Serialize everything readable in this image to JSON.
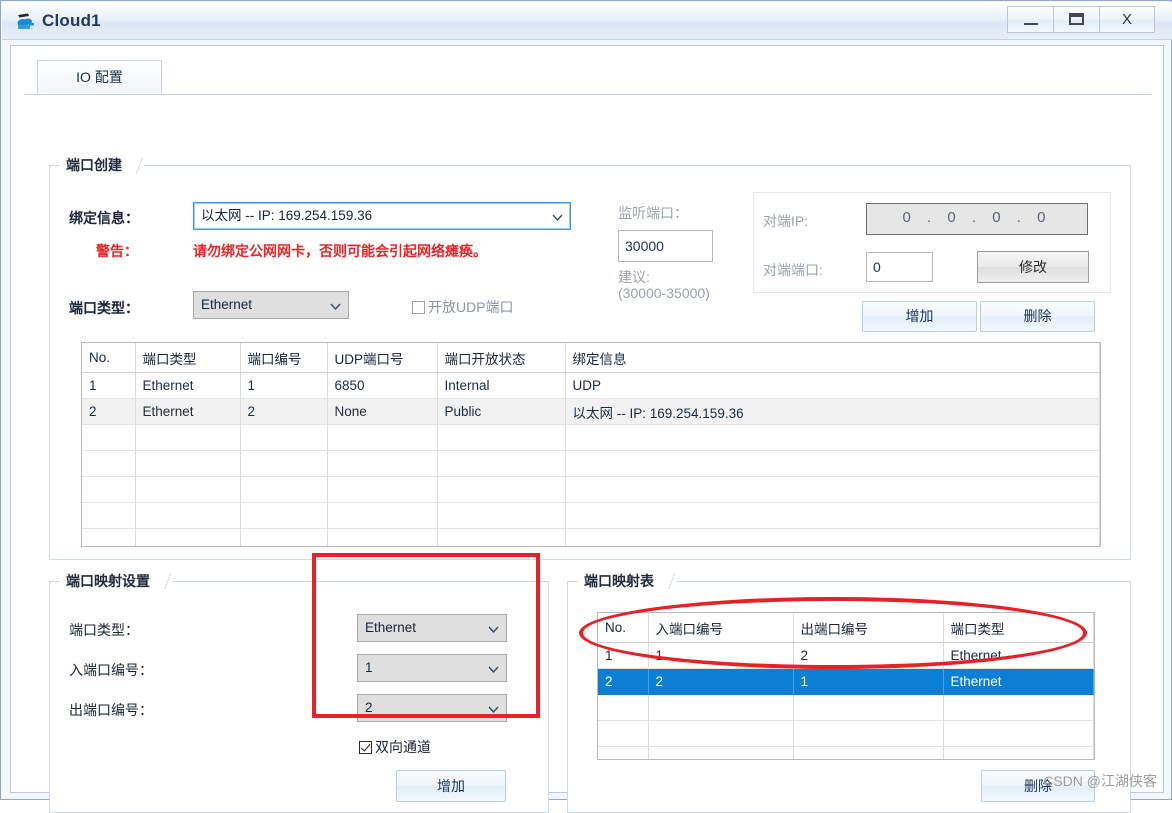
{
  "window": {
    "title": "Cloud1",
    "icon": "cloud-device-icon",
    "controls": {
      "minimize": "minimize-icon",
      "maximize": "maximize-icon",
      "close": "X"
    }
  },
  "tabs": [
    {
      "label": "IO 配置",
      "active": true
    }
  ],
  "port_create": {
    "group_title": "端口创建",
    "bind_info_label": "绑定信息：",
    "bind_info_value": "以太网 -- IP: 169.254.159.36",
    "warning_label": "警告：",
    "warning_text": "请勿绑定公网网卡，否则可能会引起网络瘫痪。",
    "port_type_label": "端口类型：",
    "port_type_value": "Ethernet",
    "udp_checkbox_label": "开放UDP端口",
    "udp_checkbox_checked": false,
    "listen_port_label": "监听端口：",
    "listen_port_value": "30000",
    "suggest_label": "建议:",
    "suggest_range": "(30000-35000)",
    "peer_ip_label": "对端IP:",
    "peer_ip_value": "0 . 0 . 0 . 0",
    "peer_port_label": "对端端口:",
    "peer_port_value": "0",
    "modify_button": "修改",
    "add_button": "增加",
    "delete_button": "删除"
  },
  "port_table": {
    "columns": [
      "No.",
      "端口类型",
      "端口编号",
      "UDP端口号",
      "端口开放状态",
      "绑定信息"
    ],
    "rows": [
      {
        "no": "1",
        "type": "Ethernet",
        "number": "1",
        "udp_port": "6850",
        "state": "Internal",
        "bind": "UDP",
        "selected": false
      },
      {
        "no": "2",
        "type": "Ethernet",
        "number": "2",
        "udp_port": "None",
        "state": "Public",
        "bind": "以太网 -- IP: 169.254.159.36",
        "selected": false
      }
    ],
    "empty_rows": 6
  },
  "mapping_settings": {
    "group_title": "端口映射设置",
    "port_type_label": "端口类型：",
    "port_type_value": "Ethernet",
    "in_port_label": "入端口编号：",
    "in_port_value": "1",
    "out_port_label": "出端口编号：",
    "out_port_value": "2",
    "bidirectional_label": "双向通道",
    "bidirectional_checked": true,
    "add_button": "增加"
  },
  "mapping_table": {
    "group_title": "端口映射表",
    "columns": [
      "No.",
      "入端口编号",
      "出端口编号",
      "端口类型"
    ],
    "rows": [
      {
        "no": "1",
        "in_port": "1",
        "out_port": "2",
        "type": "Ethernet",
        "selected": false
      },
      {
        "no": "2",
        "in_port": "2",
        "out_port": "1",
        "type": "Ethernet",
        "selected": true
      }
    ],
    "empty_rows": 3,
    "delete_button": "删除"
  },
  "annotations": {
    "highlight_box_color": "#ea2227",
    "highlight_ellipse_color": "#e62127"
  },
  "watermark": "CSDN @江湖侠客"
}
